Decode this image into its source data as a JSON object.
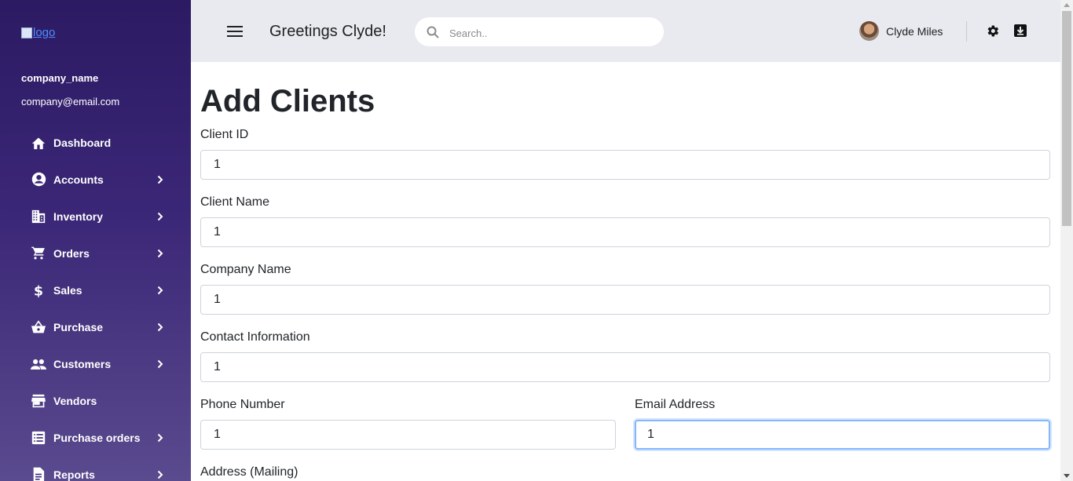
{
  "sidebar": {
    "logo_alt": "logo",
    "company_name": "company_name",
    "company_email": "company@email.com",
    "items": [
      {
        "label": "Dashboard",
        "icon": "home-icon",
        "has_submenu": false
      },
      {
        "label": "Accounts",
        "icon": "account-circle-icon",
        "has_submenu": true
      },
      {
        "label": "Inventory",
        "icon": "building-icon",
        "has_submenu": true
      },
      {
        "label": "Orders",
        "icon": "cart-icon",
        "has_submenu": true
      },
      {
        "label": "Sales",
        "icon": "dollar-icon",
        "has_submenu": true
      },
      {
        "label": "Purchase",
        "icon": "basket-icon",
        "has_submenu": true
      },
      {
        "label": "Customers",
        "icon": "people-icon",
        "has_submenu": true
      },
      {
        "label": "Vendors",
        "icon": "store-icon",
        "has_submenu": false
      },
      {
        "label": "Purchase orders",
        "icon": "list-icon",
        "has_submenu": true
      },
      {
        "label": "Reports",
        "icon": "report-icon",
        "has_submenu": true
      }
    ]
  },
  "header": {
    "greeting": "Greetings Clyde!",
    "search_placeholder": "Search..",
    "user_name": "Clyde Miles"
  },
  "main": {
    "title": "Add Clients",
    "fields": {
      "client_id": {
        "label": "Client ID",
        "value": "1"
      },
      "client_name": {
        "label": "Client Name",
        "value": "1"
      },
      "company_name": {
        "label": "Company Name",
        "value": "1"
      },
      "contact_information": {
        "label": "Contact Information",
        "value": "1"
      },
      "phone_number": {
        "label": "Phone Number",
        "value": "1"
      },
      "email_address": {
        "label": "Email Address",
        "value": "1"
      },
      "address_mailing": {
        "label": "Address (Mailing)"
      }
    }
  },
  "colors": {
    "sidebar_top": "#2c1a63",
    "sidebar_bottom": "#5a4a8e",
    "header_bg": "#e9eaf0",
    "focus_border": "#86b7fe"
  }
}
